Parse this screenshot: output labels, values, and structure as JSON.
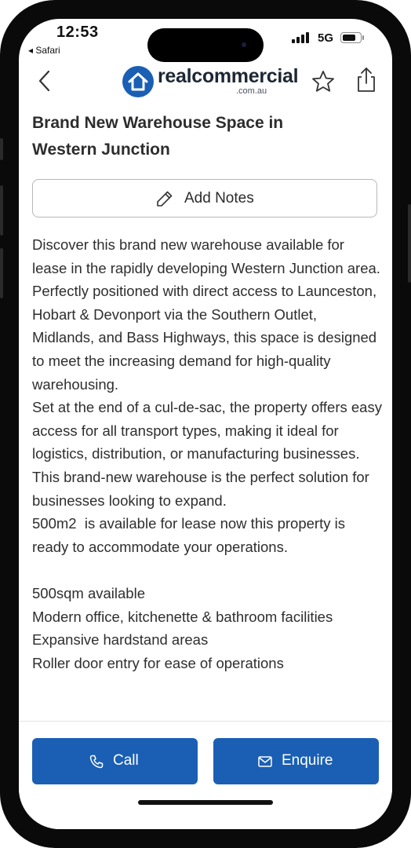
{
  "status_bar": {
    "time": "12:53",
    "back_app": "◂ Safari",
    "network": "5G",
    "battery_level": 0.8
  },
  "header": {
    "back_icon": "chevron-left-icon",
    "logo_text": "realcommercial",
    "logo_sub": ".com.au",
    "favourite_icon": "star-icon",
    "share_icon": "share-icon"
  },
  "listing": {
    "title": "Brand New Warehouse Space in Western Junction",
    "add_notes_label": "Add Notes",
    "description": "Discover this brand new warehouse available for lease in the rapidly developing Western Junction area. Perfectly positioned with direct access to Launceston, Hobart & Devonport via the Southern Outlet, Midlands, and Bass Highways, this space is designed to meet the increasing demand for high-quality warehousing.\nSet at the end of a cul-de-sac, the property offers easy access for all transport types, making it ideal for logistics, distribution, or manufacturing businesses.\nThis brand-new warehouse is the perfect solution for businesses looking to expand.\n500m2  is available for lease now this property is ready to accommodate your operations.\n\n500sqm available\nModern office, kitchenette & bathroom facilities\nExpansive hardstand areas\nRoller door entry for ease of operations"
  },
  "actions": {
    "call_label": "Call",
    "enquire_label": "Enquire"
  },
  "colors": {
    "brand_blue": "#1a5fb4",
    "text_dark": "#2d2d2d"
  }
}
